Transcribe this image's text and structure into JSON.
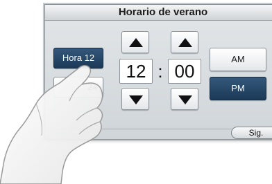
{
  "dialog": {
    "title": "Horario de verano"
  },
  "hour_format": {
    "option_12": "Hora 12",
    "option_24": "24",
    "selected": "Hora 12"
  },
  "time": {
    "hour": "12",
    "separator": ":",
    "minute": "00"
  },
  "meridiem": {
    "am_label": "AM",
    "pm_label": "PM",
    "selected": "PM"
  },
  "footer": {
    "next_label": "Sig."
  },
  "icons": {
    "increase": "up-triangle-icon",
    "decrease": "down-triangle-icon",
    "pointer": "pointing-hand-icon"
  },
  "colors": {
    "selected_button": "#1c3957",
    "panel": "#d0d5d9"
  }
}
